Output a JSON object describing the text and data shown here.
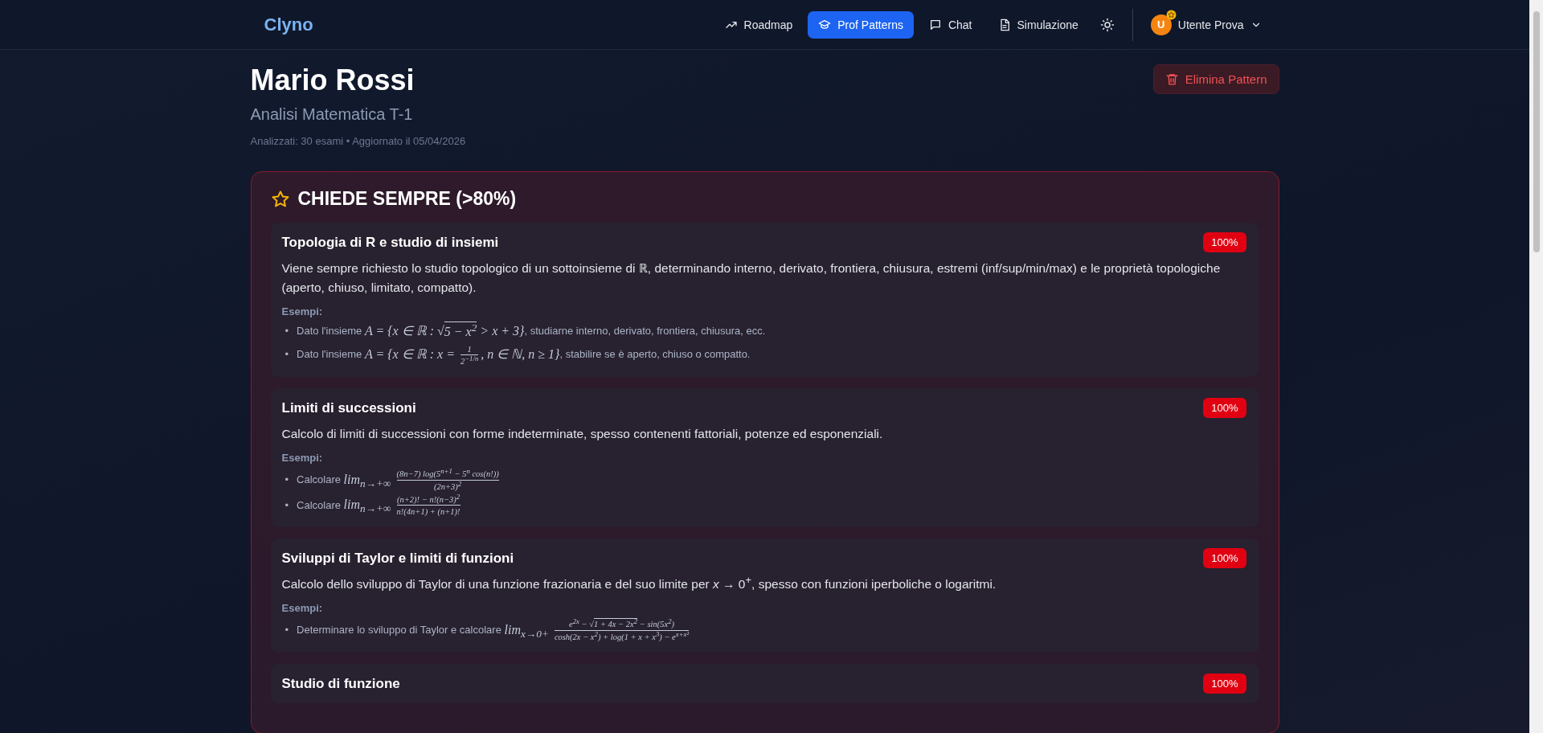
{
  "header": {
    "logo": "Clyno",
    "nav": [
      {
        "label": "Roadmap",
        "selected": false
      },
      {
        "label": "Prof Patterns",
        "selected": true
      },
      {
        "label": "Chat",
        "selected": false
      },
      {
        "label": "Simulazione",
        "selected": false
      }
    ],
    "user": {
      "initial": "U",
      "name": "Utente Prova"
    }
  },
  "professor": {
    "name": "Mario Rossi",
    "course": "Analisi Matematica T-1",
    "meta": "Analizzati: 30 esami • Aggiornato il 05/04/2026",
    "delete_button": "Elimina Pattern"
  },
  "section": {
    "title": "CHIEDE SEMPRE (>80%)",
    "items": [
      {
        "title": "Topologia di R e studio di insiemi",
        "badge": "100%",
        "description": "Viene sempre richiesto lo studio topologico di un sottoinsieme di ℝ, determinando interno, derivato, frontiera, chiusura, estremi (inf/sup/min/max) e le proprietà topologiche (aperto, chiuso, limitato, compatto).",
        "examples_label": "Esempi:",
        "examples": [
          {
            "marker": "•",
            "parts": [
              {
                "kind": "text",
                "text": "Dato l'insieme "
              },
              {
                "kind": "math",
                "text": "A = {x ∈ ℝ : √"
              },
              {
                "kind": "over",
                "text": "5 − x$^{2}$"
              },
              {
                "kind": "math",
                "text": " > x + 3}"
              },
              {
                "kind": "text",
                "text": ", studiarne interno, derivato, frontiera, chiusura, ecc."
              }
            ]
          },
          {
            "marker": "•",
            "parts": [
              {
                "kind": "text",
                "text": "Dato l'insieme "
              },
              {
                "kind": "math",
                "text": "A = {x ∈ ℝ : x = "
              },
              {
                "kind": "frac",
                "num": [
                  {
                    "kind": "math",
                    "text": "1"
                  }
                ],
                "den": [
                  {
                    "kind": "math",
                    "text": "2$^{−1/n}$"
                  }
                ]
              },
              {
                "kind": "math",
                "text": ", n ∈ ℕ, n ≥ 1}"
              },
              {
                "kind": "text",
                "text": ", stabilire se è aperto, chiuso o compatto."
              }
            ]
          }
        ]
      },
      {
        "title": "Limiti di successioni",
        "badge": "100%",
        "description": "Calcolo di limiti di successioni con forme indeterminate, spesso contenenti fattoriali, potenze ed esponenziali.",
        "examples_label": "Esempi:",
        "examples": [
          {
            "marker": "•",
            "parts": [
              {
                "kind": "text",
                "text": "Calcolare "
              },
              {
                "kind": "math",
                "text": "lim$_{n→+∞}$ "
              },
              {
                "kind": "frac",
                "num": [
                  {
                    "kind": "math",
                    "text": "(8n−7) log(5$^{n+1}$ − 5$^{n}$ cos(n!))"
                  }
                ],
                "den": [
                  {
                    "kind": "math",
                    "text": "(2n+3)$^{2}$"
                  }
                ]
              }
            ]
          },
          {
            "marker": "•",
            "parts": [
              {
                "kind": "text",
                "text": "Calcolare "
              },
              {
                "kind": "math",
                "text": "lim$_{n→+∞}$ "
              },
              {
                "kind": "frac",
                "num": [
                  {
                    "kind": "math",
                    "text": "(n+2)! − n!(n−3)$^{2}$"
                  }
                ],
                "den": [
                  {
                    "kind": "math",
                    "text": "n!(4n+1) + (n+1)!"
                  }
                ]
              }
            ]
          }
        ]
      },
      {
        "title": "Sviluppi di Taylor e limiti di funzioni",
        "badge": "100%",
        "description": "Calcolo dello sviluppo di Taylor di una funzione frazionaria e del suo limite per *x* → 0$^{+}$, spesso con funzioni iperboliche o logaritmi.",
        "examples_label": "Esempi:",
        "examples": [
          {
            "marker": "•",
            "parts": [
              {
                "kind": "text",
                "text": "Determinare lo sviluppo di Taylor e calcolare "
              },
              {
                "kind": "math",
                "text": "lim$_{x→0+}$ "
              },
              {
                "kind": "frac",
                "num": [
                  {
                    "kind": "math",
                    "text": "e$^{2x}$ − √"
                  },
                  {
                    "kind": "over",
                    "text": "1 + 4x − 2x$^{2}$"
                  },
                  {
                    "kind": "math",
                    "text": " − sin(5x$^{2}$)"
                  }
                ],
                "den": [
                  {
                    "kind": "math",
                    "text": "cosh(2x − x$^{2}$) + log(1 + x + x$^{3}$) − e$^{x+x²}$"
                  }
                ]
              }
            ]
          }
        ]
      },
      {
        "title": "Studio di funzione",
        "badge": "100%"
      }
    ]
  }
}
